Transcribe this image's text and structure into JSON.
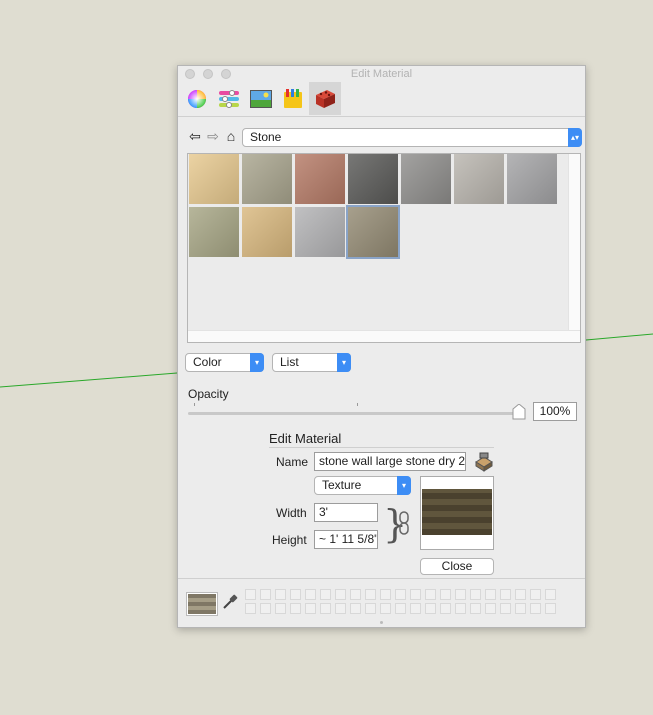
{
  "window": {
    "title": "Edit Material"
  },
  "toolbar": {
    "tabs": [
      {
        "name": "color-wheel-icon"
      },
      {
        "name": "color-sliders-icon"
      },
      {
        "name": "image-palette-icon"
      },
      {
        "name": "crayons-icon"
      },
      {
        "name": "brick-icon",
        "active": true
      }
    ]
  },
  "nav": {
    "back_icon": "back-arrow-icon",
    "forward_icon": "forward-arrow-icon",
    "home_icon": "home-icon",
    "library_value": "Stone"
  },
  "materials": {
    "tiles": [
      {
        "name": "sandstone",
        "color": "#e7c98f"
      },
      {
        "name": "fieldstone-wall",
        "color": "#a9a58e"
      },
      {
        "name": "red-brick-stone",
        "color": "#b57a66"
      },
      {
        "name": "dark-pebbles",
        "color": "#5a5a58"
      },
      {
        "name": "gray-flagstone",
        "color": "#8f8e8c"
      },
      {
        "name": "pavers",
        "color": "#b9b5ae"
      },
      {
        "name": "gray-granite",
        "color": "#a4a4a6"
      },
      {
        "name": "green-slate",
        "color": "#a7a685"
      },
      {
        "name": "tan-ashlar",
        "color": "#d9b87e"
      },
      {
        "name": "marble-gray",
        "color": "#b3b3b5"
      },
      {
        "name": "stone-wall-large",
        "color": "#948b74",
        "selected": true
      }
    ]
  },
  "mode": {
    "color_label": "Color",
    "view_label": "List"
  },
  "opacity": {
    "label": "Opacity",
    "value": "100%",
    "fraction": 1.0
  },
  "edit_material": {
    "heading": "Edit Material",
    "name_label": "Name",
    "name_value": "stone wall large stone dry 2",
    "texture_label": "Texture",
    "width_label": "Width",
    "width_value": "3'",
    "height_label": "Height",
    "height_value": "~ 1' 11 5/8\"",
    "close_label": "Close"
  },
  "colors": {
    "accent": "#3d8df5",
    "axis_green": "#2aa82a"
  }
}
